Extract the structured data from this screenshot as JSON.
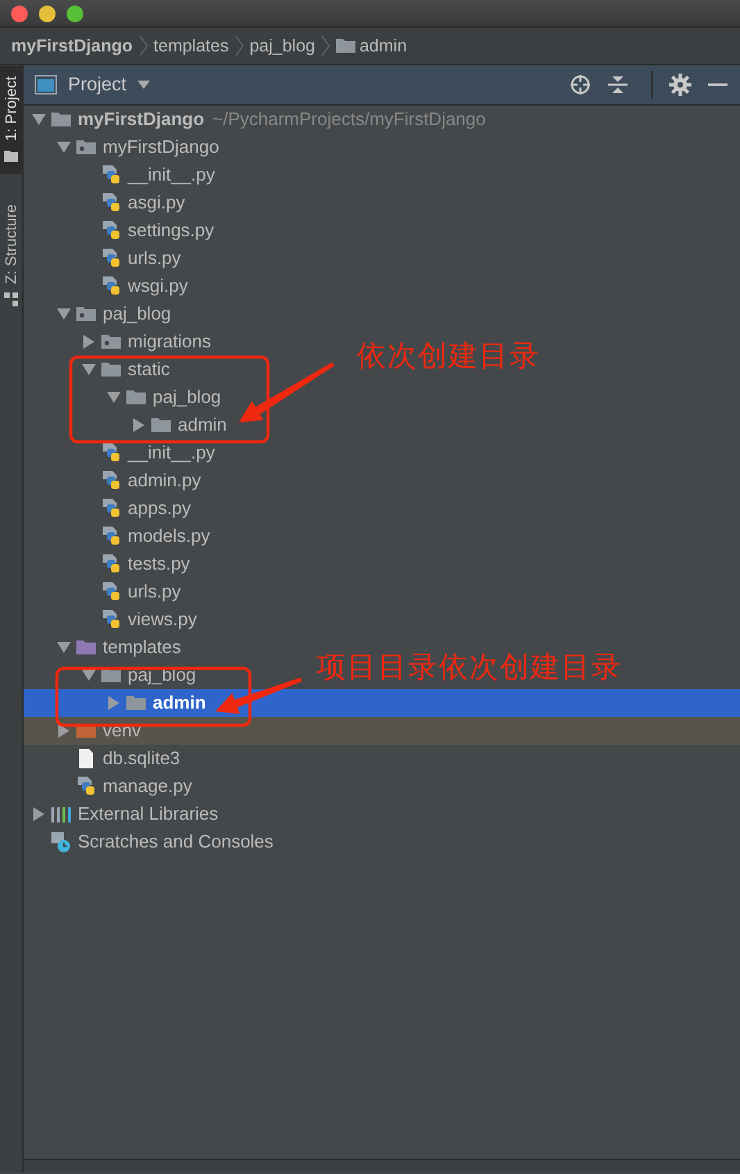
{
  "breadcrumb": [
    {
      "label": "myFirstDjango"
    },
    {
      "label": "templates"
    },
    {
      "label": "paj_blog"
    },
    {
      "label": "admin"
    }
  ],
  "side_tabs": [
    {
      "label": "1: Project",
      "selected": true
    },
    {
      "label": "Z: Structure",
      "selected": false
    }
  ],
  "panel": {
    "title": "Project"
  },
  "tree": [
    {
      "label": "myFirstDjango",
      "path": "~/PycharmProjects/myFirstDjango",
      "kind": "folder",
      "expanded": true,
      "selected": false,
      "children": [
        {
          "label": "myFirstDjango",
          "kind": "package",
          "expanded": true,
          "selected": false,
          "children": [
            {
              "label": "__init__.py",
              "kind": "python",
              "selected": false
            },
            {
              "label": "asgi.py",
              "kind": "python",
              "selected": false
            },
            {
              "label": "settings.py",
              "kind": "python",
              "selected": false
            },
            {
              "label": "urls.py",
              "kind": "python",
              "selected": false
            },
            {
              "label": "wsgi.py",
              "kind": "python",
              "selected": false
            }
          ]
        },
        {
          "label": "paj_blog",
          "kind": "package",
          "expanded": true,
          "selected": false,
          "children": [
            {
              "label": "migrations",
              "kind": "package",
              "expanded": false,
              "selected": false
            },
            {
              "label": "static",
              "kind": "folder",
              "expanded": true,
              "selected": false,
              "children": [
                {
                  "label": "paj_blog",
                  "kind": "folder",
                  "expanded": true,
                  "selected": false,
                  "children": [
                    {
                      "label": "admin",
                      "kind": "folder",
                      "expanded": false,
                      "selected": false
                    }
                  ]
                }
              ]
            },
            {
              "label": "__init__.py",
              "kind": "python",
              "selected": false
            },
            {
              "label": "admin.py",
              "kind": "python",
              "selected": false
            },
            {
              "label": "apps.py",
              "kind": "python",
              "selected": false
            },
            {
              "label": "models.py",
              "kind": "python",
              "selected": false
            },
            {
              "label": "tests.py",
              "kind": "python",
              "selected": false
            },
            {
              "label": "urls.py",
              "kind": "python",
              "selected": false
            },
            {
              "label": "views.py",
              "kind": "python",
              "selected": false
            }
          ]
        },
        {
          "label": "templates",
          "kind": "templates",
          "expanded": true,
          "selected": false,
          "children": [
            {
              "label": "paj_blog",
              "kind": "folder",
              "expanded": true,
              "selected": false,
              "children": [
                {
                  "label": "admin",
                  "kind": "folder",
                  "expanded": false,
                  "selected": true
                }
              ]
            }
          ]
        },
        {
          "label": "venv",
          "kind": "excluded",
          "expanded": false,
          "selected": false
        },
        {
          "label": "db.sqlite3",
          "kind": "file",
          "selected": false
        },
        {
          "label": "manage.py",
          "kind": "python",
          "selected": false
        }
      ]
    },
    {
      "label": "External Libraries",
      "kind": "libraries",
      "expanded": false,
      "selected": false
    },
    {
      "label": "Scratches and Consoles",
      "kind": "scratches",
      "selected": false
    }
  ],
  "annotations": [
    {
      "text": "依次创建目录"
    },
    {
      "text": "项目目录依次创建目录"
    }
  ]
}
